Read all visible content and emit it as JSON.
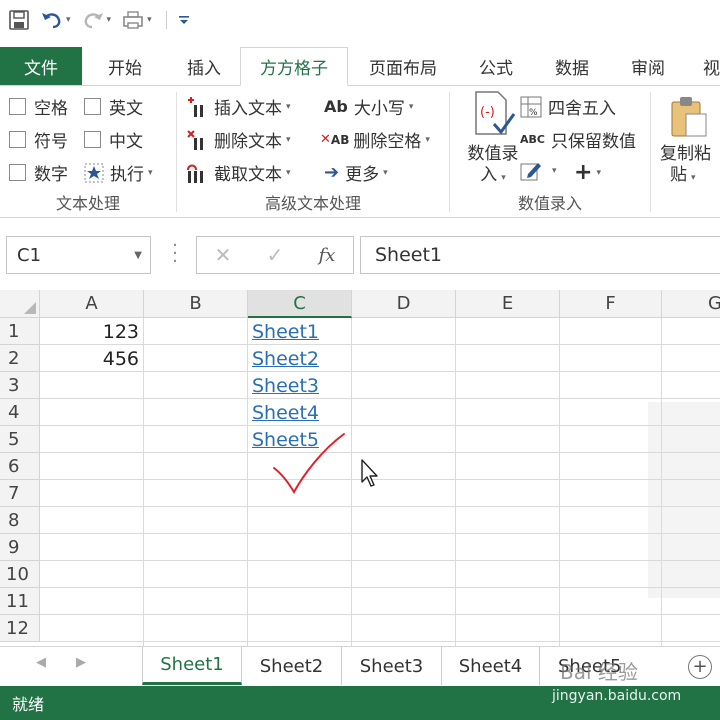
{
  "tabs": [
    "文件",
    "开始",
    "插入",
    "方方格子",
    "页面布局",
    "公式",
    "数据",
    "审阅",
    "视"
  ],
  "active_tab": "方方格子",
  "ribbon": {
    "text_group": {
      "label": "文本处理",
      "checks": [
        "空格",
        "英文",
        "符号",
        "中文",
        "数字"
      ],
      "exec": "执行"
    },
    "adv_group": {
      "label": "高级文本处理",
      "insert": "插入文本",
      "delete": "删除文本",
      "extract": "截取文本",
      "case": "大小写",
      "delete_space": "删除空格",
      "more": "更多",
      "case_icon": "Ab",
      "space_icon": "AB"
    },
    "num_group": {
      "label": "数值录入",
      "big_btn_line1": "数值录",
      "big_btn_line2": "入",
      "round": "四舍五入",
      "keep_num": "只保留数值",
      "abc_icon": "ABC",
      "plus": "+"
    },
    "copy_btn_line1": "复制粘",
    "copy_btn_line2": "贴"
  },
  "formula_bar": {
    "name_box": "C1",
    "cancel": "✕",
    "enter": "✓",
    "fx": "fx",
    "value": "Sheet1"
  },
  "grid": {
    "columns": [
      "A",
      "B",
      "C",
      "D",
      "E",
      "F",
      "G"
    ],
    "selected_column": "C",
    "rows": [
      "1",
      "2",
      "3",
      "4",
      "5",
      "6",
      "7",
      "8",
      "9",
      "10",
      "11",
      "12"
    ],
    "a_values": [
      "123",
      "456"
    ],
    "c_links": [
      "Sheet1",
      "Sheet2",
      "Sheet3",
      "Sheet4",
      "Sheet5"
    ]
  },
  "sheets": [
    "Sheet1",
    "Sheet2",
    "Sheet3",
    "Sheet4",
    "Sheet5"
  ],
  "active_sheet": "Sheet1",
  "status": "就绪",
  "watermark": {
    "line1": "Bai 经验",
    "line2": "jingyan.baidu.com"
  },
  "colors": {
    "accent": "#217346",
    "link": "#2a6fb5",
    "annotation": "#e0202a"
  }
}
